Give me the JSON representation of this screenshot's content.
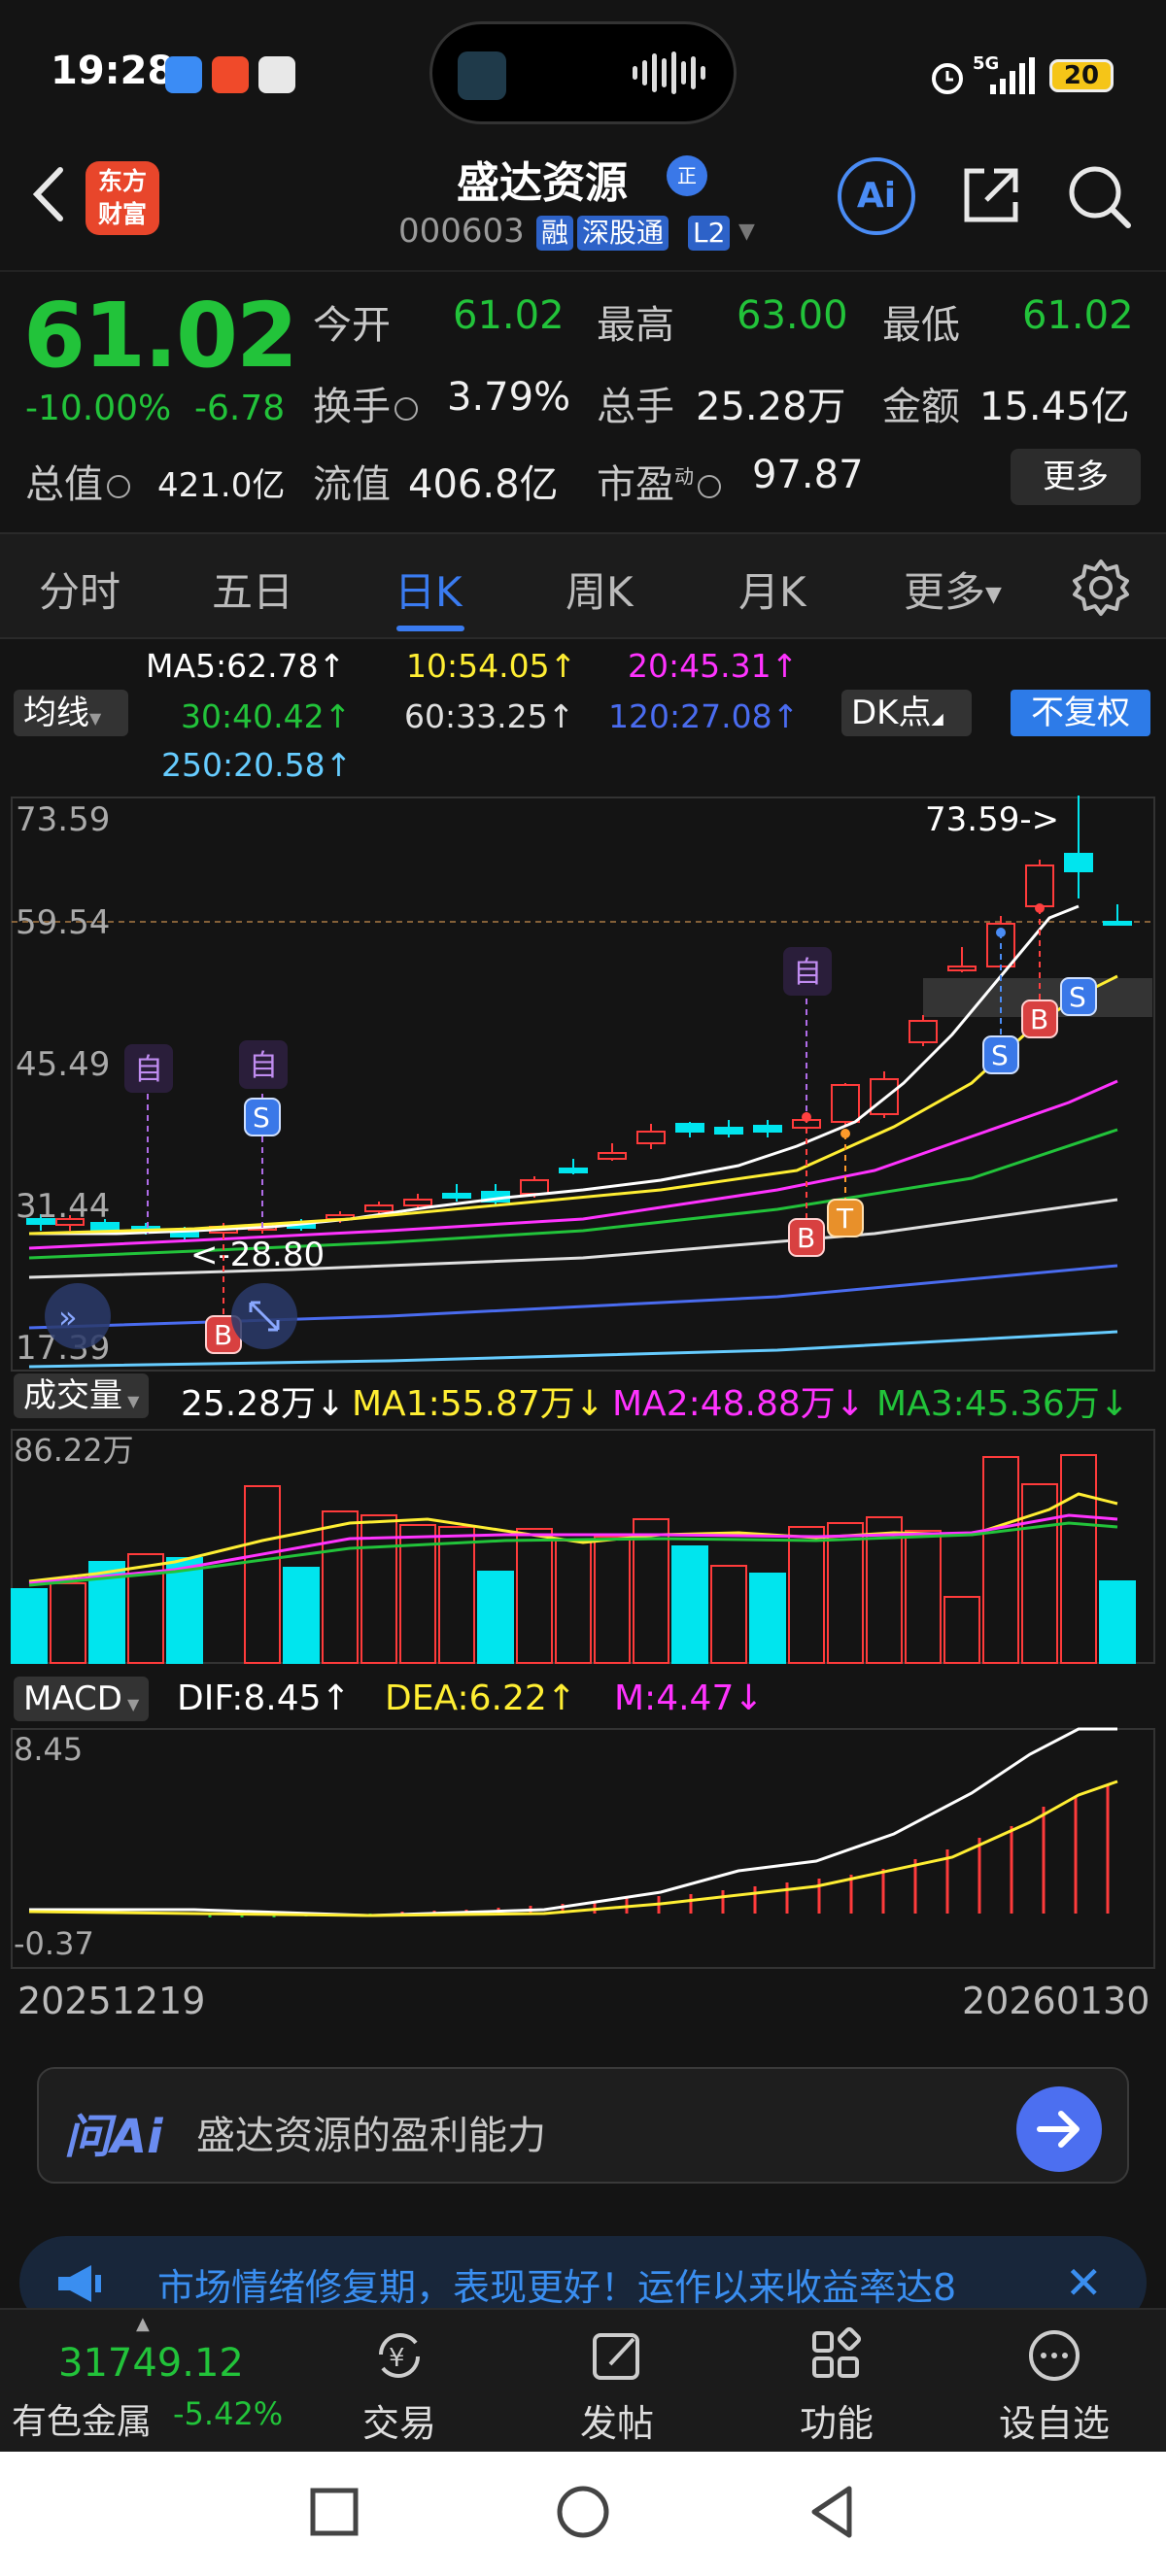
{
  "status_bar": {
    "time": "19:28",
    "network": "5G",
    "battery": "20"
  },
  "header": {
    "back_icon": "chevron-left-icon",
    "logo_line1": "东方",
    "logo_line2": "财富",
    "stock_name": "盛达资源",
    "badge": "正",
    "stock_code": "000603",
    "tags": [
      "融",
      "深股通",
      "L2"
    ],
    "ai_label": "Ai"
  },
  "quote": {
    "price": "61.02",
    "change_pct": "-10.00%",
    "change": "-6.78",
    "open_label": "今开",
    "open": "61.02",
    "high_label": "最高",
    "high": "63.00",
    "low_label": "最低",
    "low": "61.02",
    "turnover_label": "换手",
    "turnover": "3.79%",
    "volume_label": "总手",
    "volume": "25.28万",
    "amount_label": "金额",
    "amount": "15.45亿",
    "mktcap_label": "总值",
    "mktcap": "421.0亿",
    "float_label": "流值",
    "float": "406.8亿",
    "pe_label": "市盈",
    "pe_sup": "动",
    "pe": "97.87",
    "more_label": "更多"
  },
  "tabs": [
    {
      "label": "分时",
      "active": false
    },
    {
      "label": "五日",
      "active": false
    },
    {
      "label": "日K",
      "active": true
    },
    {
      "label": "周K",
      "active": false
    },
    {
      "label": "月K",
      "active": false
    },
    {
      "label": "更多",
      "active": false
    }
  ],
  "ma_legend": {
    "ma5": "MA5:62.78↑",
    "ma10": "10:54.05↑",
    "ma20": "20:45.31↑",
    "ma30": "30:40.42↑",
    "ma60": "60:33.25↑",
    "ma120": "120:27.08↑",
    "ma250": "250:20.58↑",
    "ma_select": "均线",
    "dk_select": "DK点",
    "fq_button": "不复权"
  },
  "kline_labels": {
    "y_top": "73.59",
    "y_2": "59.54",
    "y_3": "45.49",
    "y_4": "31.44",
    "y_bottom": "17.39",
    "max_marker": "73.59->",
    "min_marker": "<-28.80",
    "marker_zi": "自",
    "marker_s": "S",
    "marker_b": "B",
    "marker_t": "T"
  },
  "volume_header": {
    "select": "成交量",
    "vol": "25.28万↓",
    "ma1": "MA1:55.87万↓",
    "ma2": "MA2:48.88万↓",
    "ma3": "MA3:45.36万↓",
    "y_max": "86.22万"
  },
  "macd_header": {
    "select": "MACD",
    "dif": "DIF:8.45↑",
    "dea": "DEA:6.22↑",
    "m": "M:4.47↓",
    "y_max": "8.45",
    "y_min": "-0.37"
  },
  "dates": {
    "start": "20251219",
    "end": "20260130"
  },
  "ask_ai": {
    "logo": "问Ai",
    "text": "盛达资源的盈利能力"
  },
  "banner": {
    "text": "市场情绪修复期，表现更好！运作以来收益率达8"
  },
  "bottom_bar": {
    "index_value": "31749.12",
    "index_name": "有色金属",
    "index_pct": "-5.42%",
    "items": [
      {
        "label": "交易",
        "icon": "yen-refresh-icon"
      },
      {
        "label": "发帖",
        "icon": "edit-post-icon"
      },
      {
        "label": "功能",
        "icon": "grid-apps-icon"
      },
      {
        "label": "设自选",
        "icon": "more-dots-icon"
      }
    ]
  },
  "colors": {
    "up": "#ff3b3b",
    "down": "#22c33a",
    "cyan_candle": "#00e5ee",
    "accent": "#3a7bf0",
    "ma5": "#ffffff",
    "ma10": "#ffee33",
    "ma20": "#ff33ff",
    "ma30": "#22c33a",
    "ma60": "#e0e0e0",
    "ma120": "#4a6cf0",
    "ma250": "#66ccff"
  }
}
